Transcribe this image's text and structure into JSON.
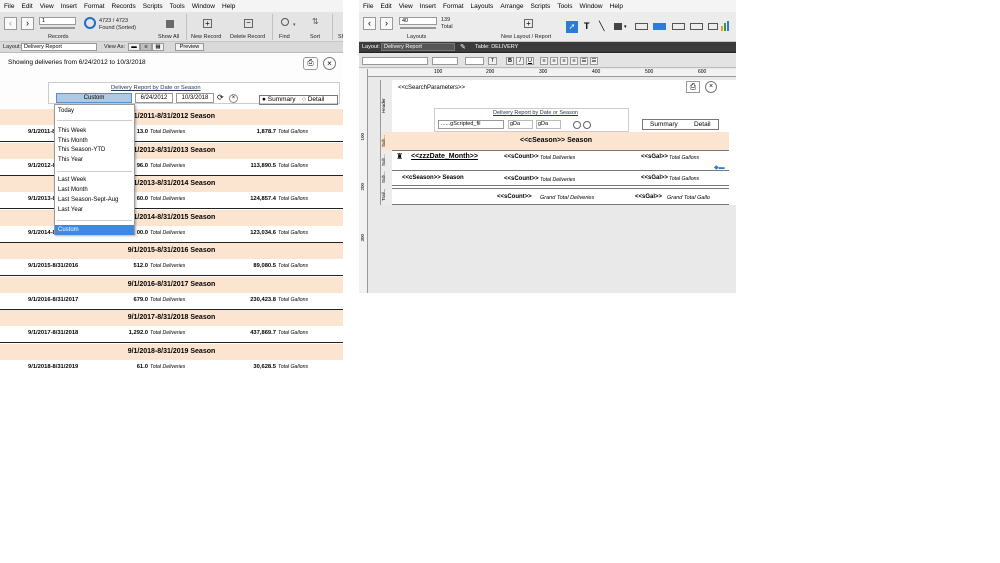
{
  "left_window": {
    "menu": [
      "File",
      "Edit",
      "View",
      "Insert",
      "Format",
      "Records",
      "Scripts",
      "Tools",
      "Window",
      "Help"
    ],
    "toolbar": {
      "record_input": "1",
      "records_label": "Records",
      "found_count": "4723 / 4723",
      "found_status": "Found (Sorted)",
      "show_all": "Show All",
      "new_record": "New Record",
      "delete_record": "Delete Record",
      "find": "Find",
      "sort": "Sort",
      "share": "Sh"
    },
    "layout_bar": {
      "layout_label": "Layout:",
      "layout_value": "Delivery Report",
      "view_as": "View As:",
      "preview": "Preview"
    },
    "showing_text": "Showing deliveries from 6/24/2012 to 10/3/2018",
    "report_title": "Delivery Report by Date or Season",
    "period_select": "Custom",
    "start_date": "6/24/2012",
    "end_date": "10/3/2018",
    "radio_summary": "Summary",
    "radio_detail": "Detail",
    "dropdown": [
      "Today",
      "This Week",
      "This Month",
      "This Season-YTD",
      "This Year",
      "Last Week",
      "Last Month",
      "Last Season-Sept-Aug",
      "Last Year",
      "Custom"
    ],
    "deliveries_label": "Total Deliveries",
    "gallons_label": "Total Gallons",
    "seasons": [
      {
        "band": "9/1/2011-8/31/2012 Season",
        "row": "9/1/2011-8/31/2012",
        "deliveries": "13.0",
        "gallons": "1,878.7"
      },
      {
        "band": "9/1/2012-8/31/2013 Season",
        "row": "9/1/2012-8/31/2013",
        "deliveries": "96.0",
        "gallons": "113,890.5"
      },
      {
        "band": "9/1/2013-8/31/2014 Season",
        "row": "9/1/2013-8/31/2014",
        "deliveries": "60.0",
        "gallons": "124,857.4"
      },
      {
        "band": "9/1/2014-8/31/2015 Season",
        "row": "9/1/2014-8/31/2015",
        "deliveries": "00.0",
        "gallons": "123,034.6"
      },
      {
        "band": "9/1/2015-8/31/2016 Season",
        "row": "9/1/2015-8/31/2016",
        "deliveries": "512.0",
        "gallons": "89,080.5"
      },
      {
        "band": "9/1/2016-8/31/2017 Season",
        "row": "9/1/2016-8/31/2017",
        "deliveries": "679.0",
        "gallons": "230,423.8"
      },
      {
        "band": "9/1/2017-8/31/2018 Season",
        "row": "9/1/2017-8/31/2018",
        "deliveries": "1,292.0",
        "gallons": "437,869.7"
      },
      {
        "band": "9/1/2018-8/31/2019 Season",
        "row": "9/1/2018-8/31/2019",
        "deliveries": "61.0",
        "gallons": "30,628.5"
      }
    ]
  },
  "right_window": {
    "menu": [
      "File",
      "Edit",
      "View",
      "Insert",
      "Format",
      "Layouts",
      "Arrange",
      "Scripts",
      "Tools",
      "Window",
      "Help"
    ],
    "toolbar": {
      "layout_input": "40",
      "layout_total": "139",
      "total_label": "Total",
      "layouts_label": "Layouts",
      "new_layout": "New Layout / Report"
    },
    "layout_bar": {
      "layout_label": "Layout:",
      "layout_value": "Delivery Report",
      "table_label": "Table: DELIVERY"
    },
    "ruler": [
      "100",
      "200",
      "300",
      "400",
      "500",
      "600"
    ],
    "vruler": [
      "100",
      "200",
      "300"
    ],
    "parts": [
      "Header",
      "Sub...",
      "Sub...",
      "Sub...",
      "Trail..."
    ],
    "search_params": "<<cSearchParameters>>",
    "report_title": "Delivery Report by Date or Season",
    "scripted_field": "......gScripted_fil",
    "g_fields": [
      "gDa",
      "gDa"
    ],
    "radio_summary": "Summary",
    "radio_detail": "Detail",
    "season_header": "<<cSeason>> Season",
    "date_month": "<<zzzDate_Month>>",
    "scount": "<<sCount>>",
    "sgal": "<<sGal>>",
    "deliveries_label": "Total Deliveries",
    "gallons_label": "Total Gallons",
    "season_sub": "<<cSeason>> Season",
    "grand_count": "<<sCount>>",
    "grand_deliveries": "Grand Total Deliveries",
    "grand_gal": "<<sGal>>",
    "grand_gallons": "Grand Total Gallo"
  }
}
